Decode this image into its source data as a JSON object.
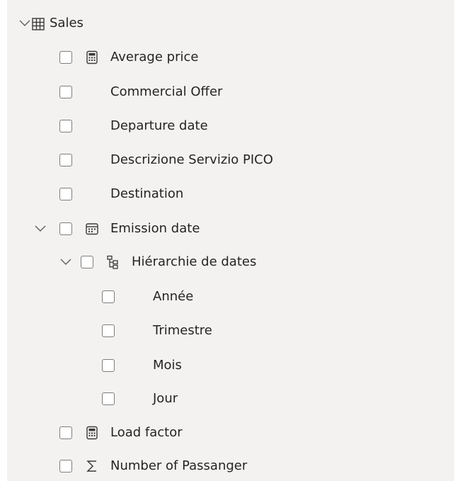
{
  "fields_pane": {
    "table": {
      "name": "Sales",
      "icon": "table-icon",
      "expanded": true
    },
    "fields": [
      {
        "label": "Average price",
        "icon": "calculator-icon",
        "checked": false
      },
      {
        "label": "Commercial Offer",
        "icon": "",
        "checked": false
      },
      {
        "label": "Departure date",
        "icon": "",
        "checked": false
      },
      {
        "label": "Descrizione Servizio PICO",
        "icon": "",
        "checked": false
      },
      {
        "label": "Destination",
        "icon": "",
        "checked": false
      },
      {
        "label": "Emission date",
        "icon": "calendar-icon",
        "checked": false,
        "expanded": true
      },
      {
        "label": "Hiérarchie de dates",
        "icon": "hierarchy-icon",
        "checked": false,
        "expanded": true
      },
      {
        "label": "Année",
        "icon": "",
        "checked": false
      },
      {
        "label": "Trimestre",
        "icon": "",
        "checked": false
      },
      {
        "label": "Mois",
        "icon": "",
        "checked": false
      },
      {
        "label": "Jour",
        "icon": "",
        "checked": false
      },
      {
        "label": "Load factor",
        "icon": "calculator-icon",
        "checked": false
      },
      {
        "label": "Number of Passanger",
        "icon": "sigma-icon",
        "checked": false
      }
    ]
  },
  "colors": {
    "pane_background": "#f3f2f1",
    "text": "#252423",
    "checkbox_border": "#7f7d7a"
  }
}
